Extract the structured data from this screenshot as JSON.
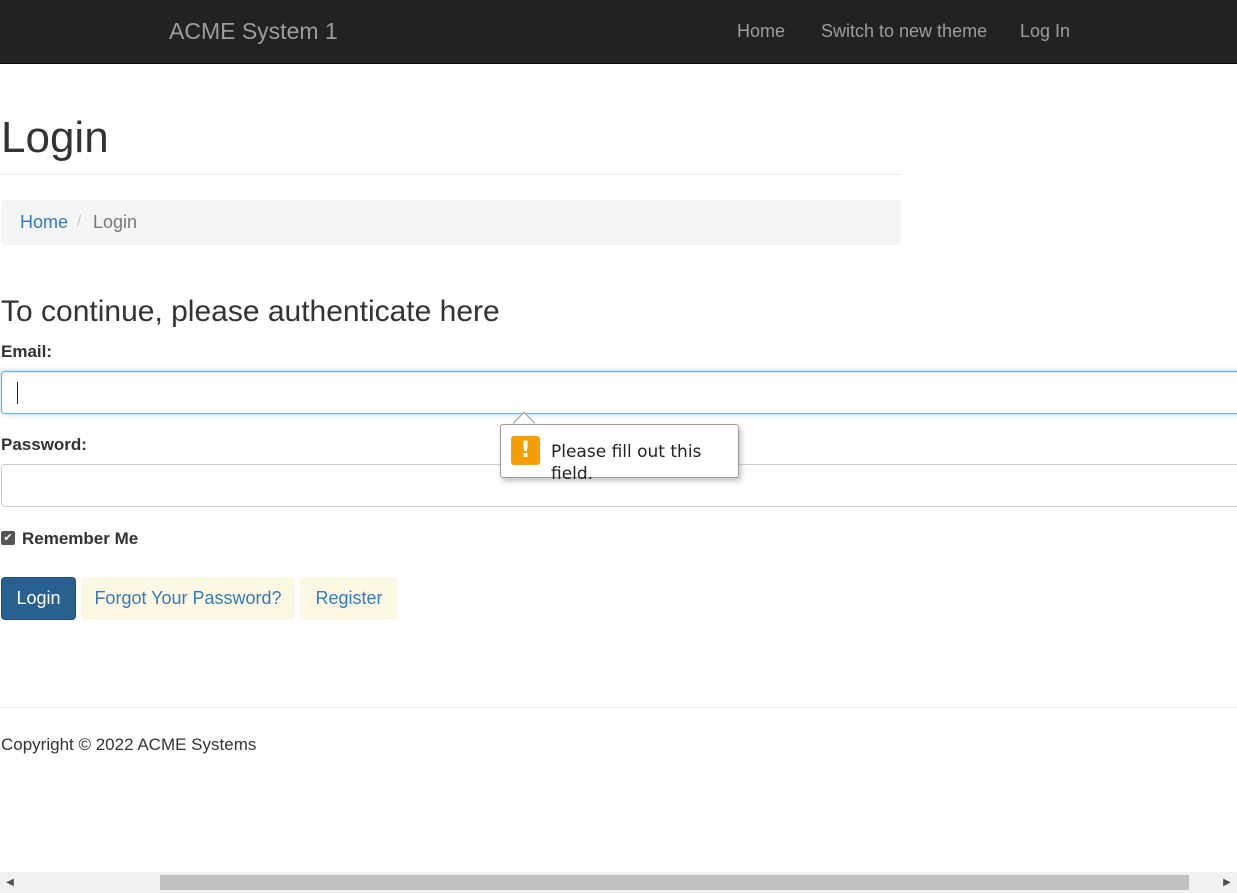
{
  "navbar": {
    "brand": "ACME System 1",
    "links": [
      {
        "label": "Home"
      },
      {
        "label": "Switch to new theme"
      },
      {
        "label": "Log In"
      }
    ]
  },
  "page": {
    "title": "Login"
  },
  "breadcrumb": {
    "items": [
      "Home",
      "Login"
    ],
    "separator": "/"
  },
  "form": {
    "heading": "To continue, please authenticate here",
    "email_label": "Email:",
    "email_value": "",
    "password_label": "Password:",
    "password_value": "",
    "remember_label": "Remember Me",
    "remember_checked": true,
    "login_button": "Login",
    "forgot_button": "Forgot Your Password?",
    "register_button": "Register"
  },
  "validation_tooltip": {
    "icon": "warning-icon",
    "icon_glyph": "!",
    "message": "Please fill out this field."
  },
  "footer": {
    "copyright": "Copyright © 2022 ACME Systems"
  },
  "scrollbar": {
    "left_arrow": "◀",
    "right_arrow": "▶"
  },
  "colors": {
    "navbar_bg": "#222222",
    "link": "#337ab7",
    "primary_button": "#286090",
    "warning": "#f5a000"
  }
}
